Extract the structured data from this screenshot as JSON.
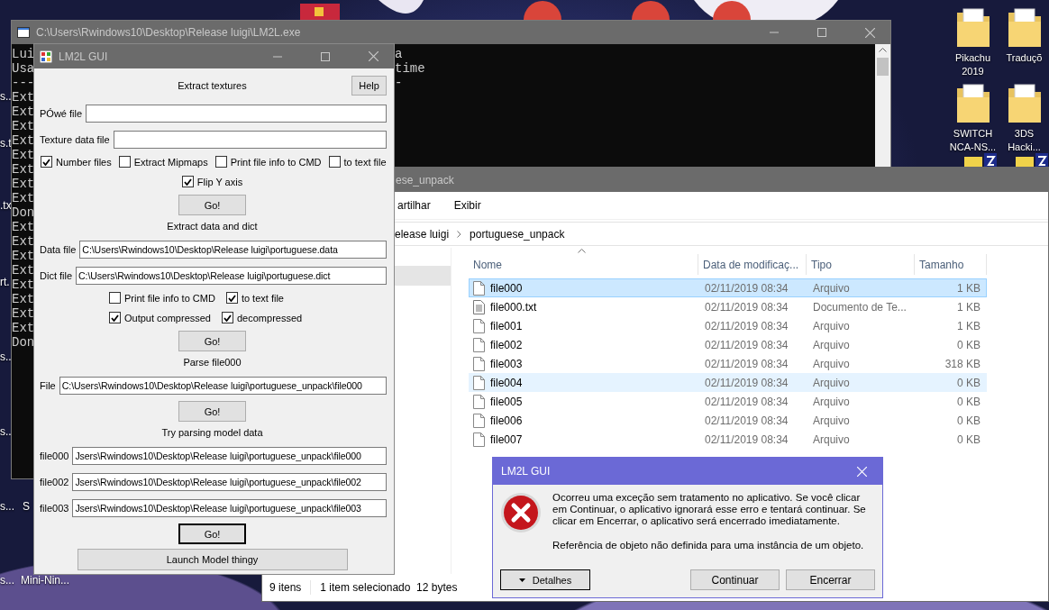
{
  "desktop": {
    "icons": [
      {
        "label": "Pikachu 2019"
      },
      {
        "label": "Traduçõ"
      },
      {
        "label": "SWITCH NCA-NS..."
      },
      {
        "label": "3DS Hacki..."
      }
    ],
    "left_labels": [
      "s..",
      "s.t",
      ".tx",
      "rt.",
      "s..",
      "s..",
      "s...",
      "s..."
    ],
    "bottom_labels": [
      "S",
      "Mini-Nin..."
    ]
  },
  "console": {
    "title": "C:\\Users\\Rwindows10\\Desktop\\Release luigi\\LM2L.exe",
    "lines": [
      {
        "left": "Lui",
        "right": "a"
      },
      {
        "left": "Usa",
        "right": "time"
      },
      {
        "left": "---",
        "right": "-"
      },
      {
        "left": "Ext"
      },
      {
        "left": "Ext"
      },
      {
        "left": "Ext"
      },
      {
        "left": "Ext"
      },
      {
        "left": "Ext"
      },
      {
        "left": "Ext"
      },
      {
        "left": "Ext"
      },
      {
        "left": "Ext"
      },
      {
        "left": "Don"
      },
      {
        "left": "Ext"
      },
      {
        "left": "Ext"
      },
      {
        "left": "Ext"
      },
      {
        "left": "Ext"
      },
      {
        "left": "Ext"
      },
      {
        "left": "Ext"
      },
      {
        "left": "Ext"
      },
      {
        "left": "Ext"
      },
      {
        "left": "Don"
      }
    ]
  },
  "explorer": {
    "title": "ese_unpack",
    "ribbon": [
      "artilhar",
      "Exibir"
    ],
    "breadcrumb": [
      "elease luigi",
      "portuguese_unpack"
    ],
    "columns": [
      "Nome",
      "Data de modificaç...",
      "Tipo",
      "Tamanho"
    ],
    "rows": [
      {
        "kind": "file",
        "name": "file000",
        "date": "02/11/2019 08:34",
        "type": "Arquivo",
        "size": "1 KB",
        "selected": true,
        "hovered": false
      },
      {
        "kind": "text",
        "name": "file000.txt",
        "date": "02/11/2019 08:34",
        "type": "Documento de Te...",
        "size": "1 KB",
        "selected": false,
        "hovered": false
      },
      {
        "kind": "file",
        "name": "file001",
        "date": "02/11/2019 08:34",
        "type": "Arquivo",
        "size": "1 KB",
        "selected": false,
        "hovered": false
      },
      {
        "kind": "file",
        "name": "file002",
        "date": "02/11/2019 08:34",
        "type": "Arquivo",
        "size": "0 KB",
        "selected": false,
        "hovered": false
      },
      {
        "kind": "file",
        "name": "file003",
        "date": "02/11/2019 08:34",
        "type": "Arquivo",
        "size": "318 KB",
        "selected": false,
        "hovered": false
      },
      {
        "kind": "file",
        "name": "file004",
        "date": "02/11/2019 08:34",
        "type": "Arquivo",
        "size": "0 KB",
        "selected": false,
        "hovered": true
      },
      {
        "kind": "file",
        "name": "file005",
        "date": "02/11/2019 08:34",
        "type": "Arquivo",
        "size": "0 KB",
        "selected": false,
        "hovered": false
      },
      {
        "kind": "file",
        "name": "file006",
        "date": "02/11/2019 08:34",
        "type": "Arquivo",
        "size": "0 KB",
        "selected": false,
        "hovered": false
      },
      {
        "kind": "file",
        "name": "file007",
        "date": "02/11/2019 08:34",
        "type": "Arquivo",
        "size": "0 KB",
        "selected": false,
        "hovered": false
      }
    ],
    "status": [
      "9 itens",
      "1 item selecionado  12 bytes"
    ]
  },
  "gui": {
    "title": "LM2L GUI",
    "items": [
      {
        "kind": "heading",
        "text": "Extract textures",
        "button": "Help"
      },
      {
        "kind": "field",
        "label": "PÓwé file"
      },
      {
        "kind": "field",
        "label": "Texture data file"
      },
      {
        "kind": "checkrow",
        "boxes": [
          {
            "label": "Number files",
            "checked": true
          },
          {
            "label": "Extract Mipmaps",
            "checked": false
          },
          {
            "label": "Print file info to CMD",
            "checked": false
          },
          {
            "label": "to text file",
            "checked": false
          }
        ]
      },
      {
        "kind": "checkrow",
        "boxes": [
          {
            "label": "Flip Y axis",
            "checked": true
          }
        ]
      },
      {
        "kind": "button",
        "text": "Go!",
        "focused": false
      },
      {
        "kind": "heading",
        "text": "Extract data and dict"
      },
      {
        "kind": "field",
        "label": "Data file",
        "value": "C:\\Users\\Rwindows10\\Desktop\\Release luigi\\portuguese.data"
      },
      {
        "kind": "field",
        "label": "Dict file",
        "value": "C:\\Users\\Rwindows10\\Desktop\\Release luigi\\portuguese.dict"
      },
      {
        "kind": "checkrow",
        "boxes": [
          {
            "label": "Print file info to CMD",
            "checked": false
          },
          {
            "label": "to text file",
            "checked": true
          }
        ]
      },
      {
        "kind": "checkrow",
        "boxes": [
          {
            "label": "Output compressed",
            "checked": true
          },
          {
            "label": "decompressed",
            "checked": true
          }
        ]
      },
      {
        "kind": "button",
        "text": "Go!",
        "focused": false
      },
      {
        "kind": "heading",
        "text": "Parse file000"
      },
      {
        "kind": "field",
        "label": "File",
        "value": "C:\\Users\\Rwindows10\\Desktop\\Release luigi\\portuguese_unpack\\file000"
      },
      {
        "kind": "button",
        "text": "Go!",
        "focused": false
      },
      {
        "kind": "heading",
        "text": "Try parsing model data"
      },
      {
        "kind": "field",
        "label": "file000",
        "value": "Jsers\\Rwindows10\\Desktop\\Release luigi\\portuguese_unpack\\file000"
      },
      {
        "kind": "field",
        "label": "file002",
        "value": "Jsers\\Rwindows10\\Desktop\\Release luigi\\portuguese_unpack\\file002"
      },
      {
        "kind": "field",
        "label": "file003",
        "value": "Jsers\\Rwindows10\\Desktop\\Release luigi\\portuguese_unpack\\file003"
      },
      {
        "kind": "button",
        "text": "Go!",
        "focused": true
      },
      {
        "kind": "wide_button",
        "text": "Launch Model thingy"
      }
    ]
  },
  "dialog": {
    "title": "LM2L GUI",
    "paragraphs": [
      "Ocorreu uma exceção sem tratamento no aplicativo. Se você clicar em Continuar, o aplicativo ignorará esse erro e tentará continuar. Se clicar em Encerrar, o aplicativo será encerrado imediatamente.",
      "Referência de objeto não definida para uma instância de um objeto."
    ],
    "details": "Detalhes",
    "buttons": [
      "Continuar",
      "Encerrar"
    ]
  }
}
